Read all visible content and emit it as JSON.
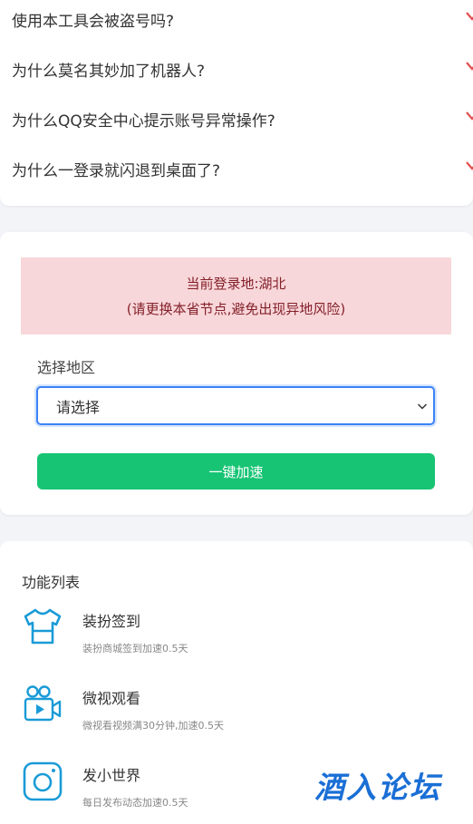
{
  "faq": {
    "items": [
      {
        "q": "使用本工具会被盗号吗?"
      },
      {
        "q": "为什么莫名其妙加了机器人?"
      },
      {
        "q": "为什么QQ安全中心提示账号异常操作?"
      },
      {
        "q": "为什么一登录就闪退到桌面了?"
      }
    ]
  },
  "speed": {
    "alert_line1": "当前登录地:湖北",
    "alert_line2": "(请更换本省节点,避免出现异地风险)",
    "region_label": "选择地区",
    "select_value": "请选择",
    "button_label": "一键加速"
  },
  "features": {
    "title": "功能列表",
    "items": [
      {
        "name": "装扮签到",
        "desc": "装扮商城签到加速0.5天",
        "icon": "tshirt-icon"
      },
      {
        "name": "微视观看",
        "desc": "微视看视频满30分钟,加速0.5天",
        "icon": "video-camera-icon"
      },
      {
        "name": "发小世界",
        "desc": "每日发布动态加速0.5天",
        "icon": "camera-icon"
      }
    ]
  },
  "watermark": {
    "text": "酒入论坛"
  },
  "colors": {
    "accent_blue": "#1a9bd7",
    "green_button": "#17c474",
    "alert_bg": "#f8d7da",
    "chevron_red": "#e05050"
  }
}
